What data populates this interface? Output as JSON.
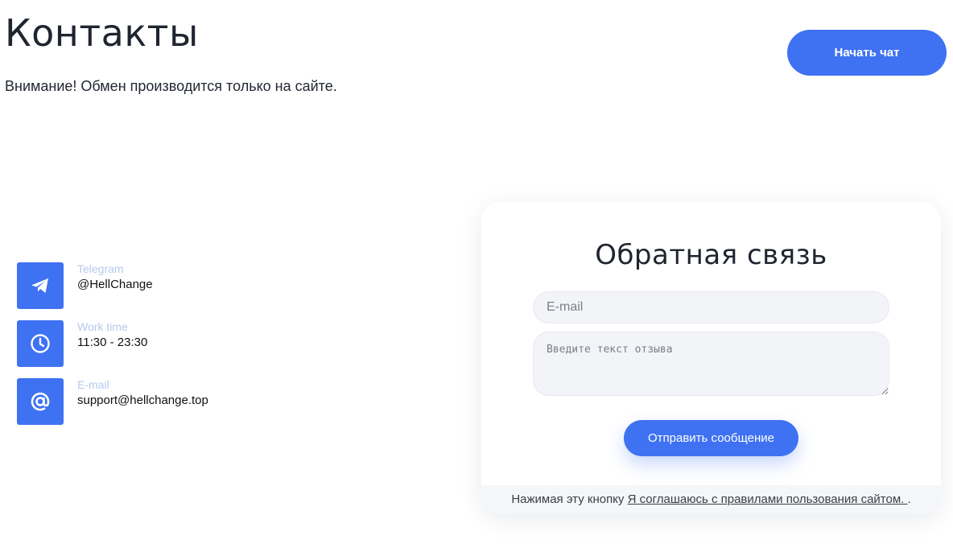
{
  "header": {
    "title": "Контакты",
    "notice": "Внимание! Обмен производится только на сайте.",
    "chat_button": "Начать чат"
  },
  "contacts": [
    {
      "icon": "telegram-icon",
      "label": "Telegram",
      "value": "@HellChange"
    },
    {
      "icon": "clock-icon",
      "label": "Work time",
      "value": "11:30 - 23:30"
    },
    {
      "icon": "at-icon",
      "label": "E-mail",
      "value": "support@hellchange.top"
    }
  ],
  "feedback": {
    "title": "Обратная связь",
    "email_placeholder": "E-mail",
    "message_placeholder": "Введите текст отзыва",
    "submit_label": "Отправить сообщение",
    "footer_prefix": "Нажимая эту кнопку ",
    "footer_link": "Я соглашаюсь с правилами пользования сайтом. ",
    "footer_suffix": "."
  },
  "colors": {
    "accent": "#3f72f2",
    "label": "#b5c9ec",
    "text": "#222833"
  }
}
